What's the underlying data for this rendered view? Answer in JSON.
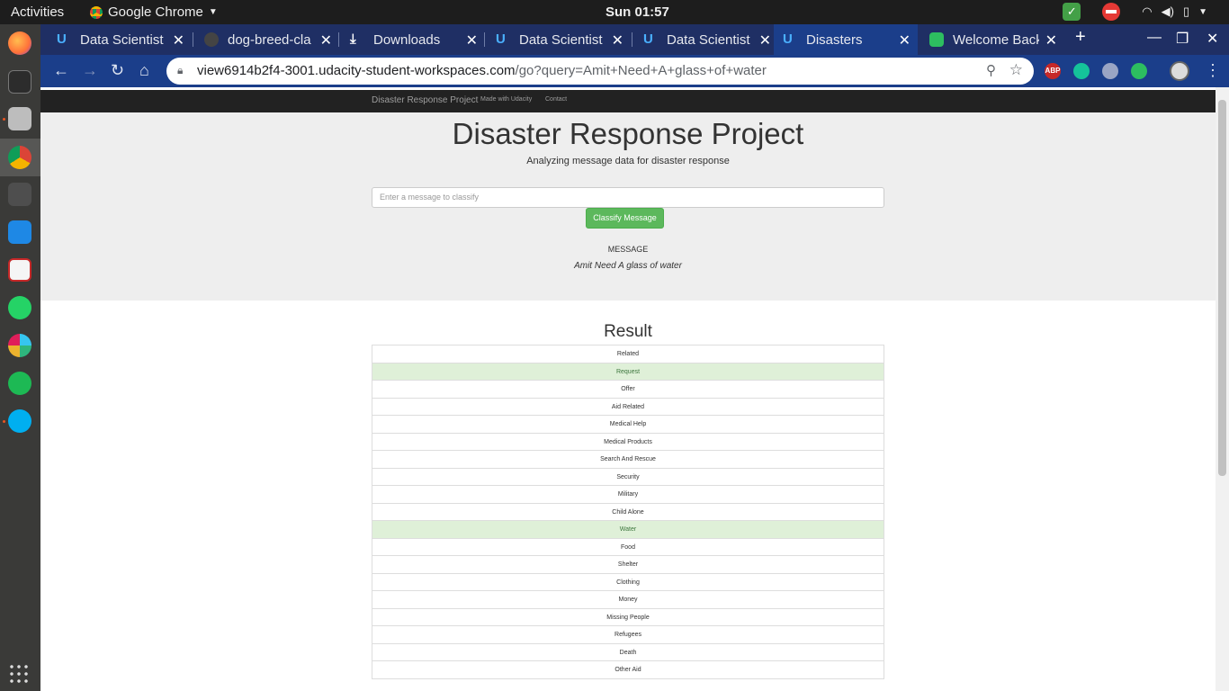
{
  "topbar": {
    "activities": "Activities",
    "app": "Google Chrome",
    "clock": "Sun 01:57"
  },
  "tabs": [
    {
      "title": "Data Scientist",
      "icon": "udacity-icon"
    },
    {
      "title": "dog-breed-cla",
      "icon": "github-icon"
    },
    {
      "title": "Downloads",
      "icon": "download-icon"
    },
    {
      "title": "Data Scientist",
      "icon": "udacity-icon"
    },
    {
      "title": "Data Scientist",
      "icon": "udacity-icon"
    },
    {
      "title": "Disasters",
      "icon": "udacity-icon",
      "active": true
    },
    {
      "title": "Welcome Back",
      "icon": "evernote-icon"
    }
  ],
  "address": {
    "host": "view6914b2f4-3001.udacity-student-workspaces.com",
    "path": "/go?query=Amit+Need+A+glass+of+water"
  },
  "extensions": {
    "abp": "ABP"
  },
  "navbar": {
    "brand": "Disaster Response Project",
    "link1": "Made with Udacity",
    "link2": "Contact"
  },
  "header": {
    "title": "Disaster Response Project",
    "subtitle": "Analyzing message data for disaster response"
  },
  "form": {
    "placeholder": "Enter a message to classify",
    "button": "Classify Message"
  },
  "message": {
    "label": "MESSAGE",
    "text": "Amit Need A glass of water"
  },
  "result": {
    "title": "Result",
    "categories": [
      {
        "name": "Related",
        "hit": false
      },
      {
        "name": "Request",
        "hit": true
      },
      {
        "name": "Offer",
        "hit": false
      },
      {
        "name": "Aid Related",
        "hit": false
      },
      {
        "name": "Medical Help",
        "hit": false
      },
      {
        "name": "Medical Products",
        "hit": false
      },
      {
        "name": "Search And Rescue",
        "hit": false
      },
      {
        "name": "Security",
        "hit": false
      },
      {
        "name": "Military",
        "hit": false
      },
      {
        "name": "Child Alone",
        "hit": false
      },
      {
        "name": "Water",
        "hit": true
      },
      {
        "name": "Food",
        "hit": false
      },
      {
        "name": "Shelter",
        "hit": false
      },
      {
        "name": "Clothing",
        "hit": false
      },
      {
        "name": "Money",
        "hit": false
      },
      {
        "name": "Missing People",
        "hit": false
      },
      {
        "name": "Refugees",
        "hit": false
      },
      {
        "name": "Death",
        "hit": false
      },
      {
        "name": "Other Aid",
        "hit": false
      }
    ]
  }
}
